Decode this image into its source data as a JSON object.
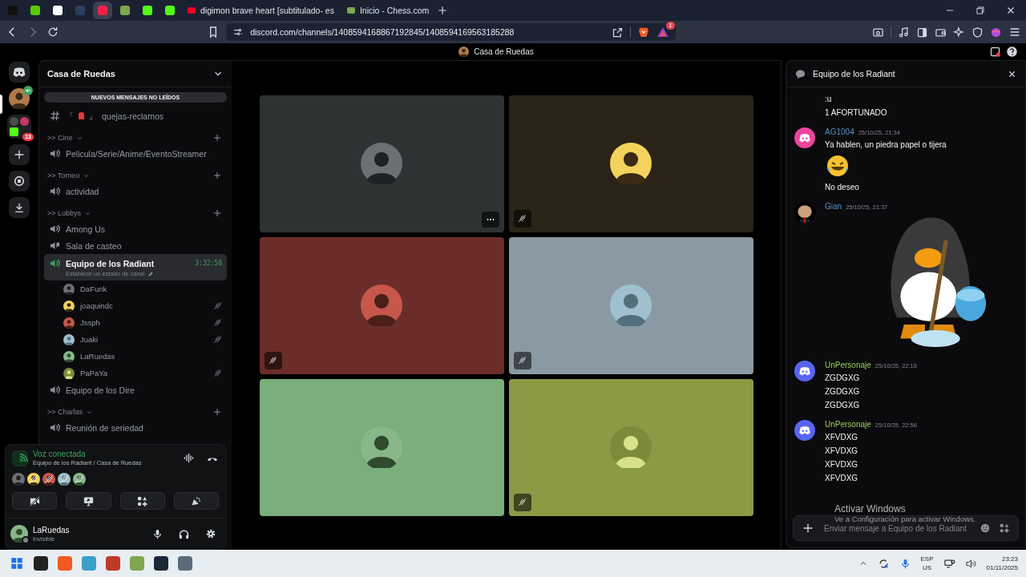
{
  "browser": {
    "pinned_tabs": [
      {
        "selected": false
      },
      {
        "selected": false
      },
      {
        "selected": false
      },
      {
        "selected": false
      },
      {
        "selected": true
      },
      {
        "selected": false
      },
      {
        "selected": false
      },
      {
        "selected": false
      }
    ],
    "tabs": [
      {
        "title": "digimon brave heart [subtitulado- es",
        "selected": false
      },
      {
        "title": "Inicio - Chess.com",
        "selected": false
      }
    ],
    "url": "discord.com/channels/1408594168867192845/1408594169563185288",
    "rewards_badge": "1"
  },
  "app": {
    "title": "Casa de Ruedas"
  },
  "servers": [
    {
      "kind": "home",
      "selected": false
    },
    {
      "kind": "server",
      "selected": true,
      "in_voice": true
    },
    {
      "kind": "folder",
      "selected": false,
      "badge": "13"
    },
    {
      "kind": "add",
      "selected": false
    },
    {
      "kind": "discover",
      "selected": false
    },
    {
      "kind": "download",
      "selected": false
    }
  ],
  "sidebar": {
    "title": "Casa de Ruedas",
    "unread_banner": "NUEVOS MENSAJES NO LEÍDOS",
    "items": [
      {
        "kind": "text",
        "prefix": "「",
        "suffix": "」",
        "label": "quejas-reclamos",
        "selected": false
      },
      {
        "kind": "category",
        "label": ">> Cine"
      },
      {
        "kind": "voice",
        "label": "Pelicula/Serie/Anime/EventoStreamer",
        "selected": false
      },
      {
        "kind": "category",
        "label": ">> Torneo"
      },
      {
        "kind": "voice",
        "label": "actividad",
        "selected": false
      },
      {
        "kind": "category",
        "label": ">> Lobbys"
      },
      {
        "kind": "voice",
        "label": "Among Us",
        "selected": false
      },
      {
        "kind": "stage",
        "label": "Sala de casteo",
        "selected": false
      },
      {
        "kind": "voice",
        "label": "Equipo de los Radiant",
        "selected": true,
        "timer": "3:32:58",
        "status": "Establece un estado de canal",
        "members": [
          {
            "name": "DaFunk",
            "muted": false
          },
          {
            "name": "joaquindc",
            "muted": true
          },
          {
            "name": "Jssph",
            "muted": true
          },
          {
            "name": "Juaki",
            "muted": true
          },
          {
            "name": "LaRuedas",
            "muted": false
          },
          {
            "name": "PaPaYa",
            "muted": true
          }
        ]
      },
      {
        "kind": "voice",
        "label": "Equipo de los Dire",
        "selected": false
      },
      {
        "kind": "category",
        "label": ">> Charlas"
      },
      {
        "kind": "voice",
        "label": "Reunión de seriedad",
        "selected": false
      }
    ]
  },
  "voice_panel": {
    "status": "Voz conectada",
    "location": "Equipo de los Radiant / Casa de Ruedas",
    "participants": [
      {
        "muted": false
      },
      {
        "muted": true
      },
      {
        "muted": true
      },
      {
        "muted": true
      },
      {
        "muted": true
      }
    ]
  },
  "user": {
    "name": "LaRuedas",
    "status": "Invisible"
  },
  "stage": {
    "tiles": [
      {
        "color": "#2f3233",
        "muted": false,
        "menu": true
      },
      {
        "color": "#2b2318",
        "muted": true,
        "menu": false
      },
      {
        "color": "#6b2d29",
        "muted": true,
        "menu": false
      },
      {
        "color": "#8a9aa3",
        "muted": true,
        "menu": false
      },
      {
        "color": "#7aae7b",
        "muted": false,
        "menu": false
      },
      {
        "color": "#8b9a45",
        "muted": true,
        "menu": false
      }
    ]
  },
  "chat": {
    "title": "Equipo de los Radiant",
    "placeholder": "Enviar mensaje a Equipo de los Radiant",
    "messages": [
      {
        "lines": [
          {
            "kind": "text",
            "text": ":u"
          },
          {
            "kind": "text",
            "text": "1 AFORTUNADO"
          }
        ]
      },
      {
        "author": "AG1004",
        "color": "#5b8ec4",
        "time": "25/10/25, 21:34",
        "avatar": {
          "kind": "default",
          "color": "#eb459e"
        },
        "lines": [
          {
            "kind": "text",
            "text": "Ya hablen, un piedra papel o tijera"
          },
          {
            "kind": "emoji"
          },
          {
            "kind": "text",
            "text": "No deseo"
          }
        ]
      },
      {
        "author": "Gian",
        "color": "#5b8ec4",
        "time": "25/10/25, 21:37",
        "avatar": {
          "kind": "picture"
        },
        "lines": [
          {
            "kind": "sticker"
          }
        ]
      },
      {
        "author": "UnPersonaje",
        "color": "#9ccc5e",
        "time": "25/10/25, 22:16",
        "avatar": {
          "kind": "default",
          "color": "#5865f2"
        },
        "lines": [
          {
            "kind": "text",
            "text": "ZGDGXG"
          },
          {
            "kind": "text",
            "text": "ZGDGXG"
          },
          {
            "kind": "text",
            "text": "ZGDGXG"
          }
        ]
      },
      {
        "author": "UnPersonaje",
        "color": "#9ccc5e",
        "time": "25/10/25, 22:56",
        "avatar": {
          "kind": "default",
          "color": "#5865f2"
        },
        "lines": [
          {
            "kind": "text",
            "text": "XFVDXG"
          },
          {
            "kind": "text",
            "text": "XFVDXG"
          },
          {
            "kind": "text",
            "text": "XFVDXG"
          },
          {
            "kind": "text",
            "text": "XFVDXG"
          }
        ]
      }
    ]
  },
  "activation_notice": {
    "title": "Activar Windows",
    "text": "Ve a Configuración para activar Windows."
  },
  "taskbar": {
    "language": "ESP",
    "layout": "US",
    "time": "23:23",
    "date": "01/11/2025"
  }
}
